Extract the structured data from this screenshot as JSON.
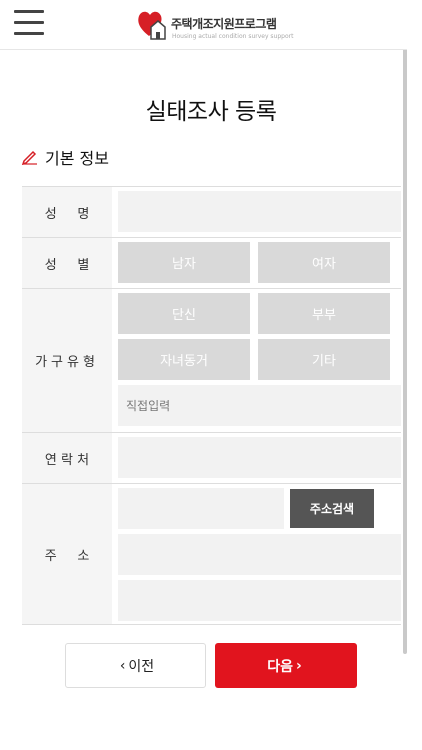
{
  "header": {
    "menu_icon": "hamburger-icon",
    "logo_title": "주택개조지원프로그램",
    "logo_subtitle": "Housing actual condition survey support"
  },
  "page": {
    "title": "실태조사 등록"
  },
  "section": {
    "title": "기본 정보",
    "icon": "pencil-icon"
  },
  "form": {
    "name_label": "성     명",
    "gender_label": "성     별",
    "gender_options": [
      "남자",
      "여자"
    ],
    "household_label": "가구유형",
    "household_options": [
      "단신",
      "부부",
      "자녀동거",
      "기타"
    ],
    "household_direct_placeholder": "직접입력",
    "contact_label": "연 락 처",
    "address_label": "주     소",
    "address_search_button": "주소검색"
  },
  "buttons": {
    "prev_label": "이전",
    "next_label": "다음",
    "accent_color": "#e1141e"
  }
}
